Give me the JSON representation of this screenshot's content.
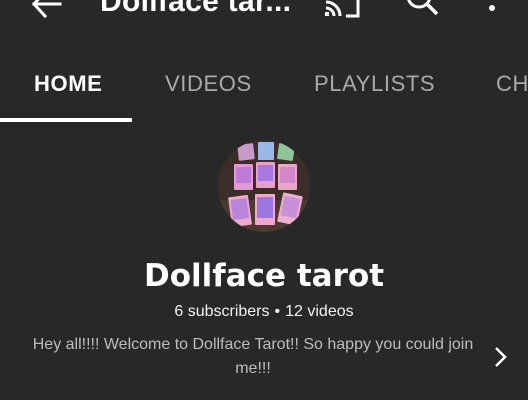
{
  "appbar": {
    "title": "Dollface tar...",
    "back_icon": "arrow-back-icon",
    "cast_icon": "cast-icon",
    "search_icon": "search-icon",
    "more_icon": "more-vert-icon"
  },
  "tabs": [
    {
      "label": "HOME",
      "active": true
    },
    {
      "label": "VIDEOS",
      "active": false
    },
    {
      "label": "PLAYLISTS",
      "active": false
    },
    {
      "label": "CH",
      "active": false
    }
  ],
  "channel": {
    "name": "Dollface tarot",
    "subscribers": "6 subscribers",
    "separator": "•",
    "videos": "12 videos",
    "description": "Hey all!!!! Welcome to Dollface Tarot!! So happy you could join me!!!",
    "avatar_icon": "tarot-cards-avatar",
    "expand_icon": "chevron-right-icon"
  },
  "colors": {
    "background": "#282828",
    "text_primary": "#ffffff",
    "text_secondary": "#aaaaaa"
  }
}
